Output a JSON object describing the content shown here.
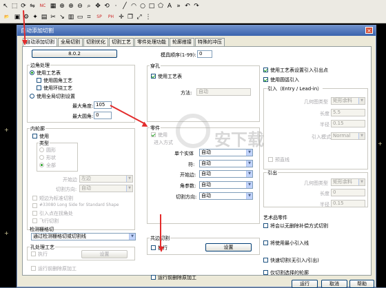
{
  "toolbar": {
    "row1_icons": [
      "cursor-icon",
      "select-icon",
      "rotate-icon",
      "mirror-icon",
      "nc-icon",
      "layout-icon",
      "zoom-icon",
      "zoom-in-icon",
      "zoom-out-icon",
      "zoom-window-icon",
      "pan-icon",
      "refresh-icon",
      "point-icon",
      "line-icon",
      "arc-icon",
      "circle-icon",
      "rect-icon",
      "polygon-icon",
      "text-icon",
      "more-icon",
      "undo-icon",
      "redo-icon"
    ],
    "row1_glyphs": [
      "↖",
      "⬚",
      "⟳",
      "⇋",
      "NC",
      "▦",
      "⊕",
      "⊕",
      "⊖",
      "⌕",
      "✥",
      "⟲",
      "·",
      "╱",
      "◠",
      "○",
      "□",
      "⬠",
      "A",
      "»",
      "↶",
      "↷"
    ],
    "row2_icons": [
      "open-icon",
      "save-icon",
      "part-icon",
      "nest-icon",
      "sheet-icon",
      "cut-icon",
      "lead-icon",
      "table-icon",
      "plate-icon",
      "grid-icon",
      "sp-icon",
      "ph-icon",
      "move-icon",
      "copy-icon",
      "scale-icon",
      "array-icon"
    ],
    "row2_glyphs": [
      "📂",
      "▣",
      "⚙",
      "✦",
      "▤",
      "✂",
      "↘",
      "▥",
      "▭",
      "⌗",
      "SP",
      "PH",
      "✛",
      "❐",
      "⤢",
      "⋮"
    ]
  },
  "dialog": {
    "title": "自动添加切割",
    "close": "×",
    "tabs": [
      "自动添加切割",
      "全局切割",
      "切割优化",
      "切割工艺",
      "零件处理功能",
      "轮廓搭接",
      "特殊的冲压"
    ],
    "active_tab": 0,
    "version_button": "8.0.2",
    "module_order_label": "模具顺序(1-99):",
    "module_order_value": "0",
    "corner": {
      "title": "边角处理",
      "use_table": "使用工艺表",
      "use_round": "使用圆角工艺",
      "use_loop": "使用环绕工艺",
      "use_global": "使用全局切割设置",
      "max_angle_label": "最大角度:",
      "max_angle_value": "105",
      "max_radius_label": "最大圆角:",
      "max_radius_value": "0"
    },
    "inner": {
      "title": "内轮廓",
      "use": "使用",
      "type_title": "类型",
      "type_round": "圆形",
      "type_shape": "形状",
      "type_all": "全部",
      "start_edge_label": "开始边",
      "start_edge_value": "左边",
      "cut_dir_label": "切割方向:",
      "cut_dir_value": "自动",
      "opt1": "短边为标准切割",
      "opt2": "#33080 Long Side for Standard Shape",
      "opt3": "引入点在拐角处",
      "opt4": "飞行切割",
      "grid_title": "检测栅格切",
      "grid_value": "通过检测栅格切或切割线",
      "hole_title": "孔处理工艺",
      "hole_exec": "执行",
      "hole_setting": "设置",
      "before_remove": "运行前删除原加工"
    },
    "pierce": {
      "title": "穿孔",
      "use_table": "使用工艺表",
      "method_label": "方法:",
      "method_value": "自动"
    },
    "part": {
      "title": "零件",
      "use": "使用",
      "lead_dir": "进入方式",
      "single_label": "单个实体",
      "single_value": "自动",
      "fill_label": "符:",
      "fill_value": "自动",
      "start_edge_label": "开始边:",
      "start_edge_value": "自动",
      "angle_label": "角参数:",
      "angle_value": "自动",
      "cut_dir_label": "切割方向:",
      "cut_dir_value": "自动"
    },
    "common": {
      "title": "共边切割",
      "exec": "执行",
      "setting": "设置"
    },
    "run_before_remove": "运行前删除原加工",
    "right": {
      "use_table_lead": "使用工艺表设置引入引出点",
      "use_round_lead": "使用圆弧引入",
      "lead_in_title": "引入（Entry / Lead-in）",
      "geom_type_label": "几何图类型",
      "geom_type_value": "矩形余料",
      "length_label": "长度",
      "length_value": "5.5",
      "radius_label": "半径",
      "radius_value": "0.15",
      "lead_mode_label": "引入模式",
      "lead_mode_value": "Normal",
      "preview": "预直线",
      "lead_out_title": "引出",
      "out_geom_type_label": "几何图类型",
      "out_geom_type_value": "矩形余料",
      "out_length_label": "长度",
      "out_length_value": "0",
      "out_radius_label": "半径",
      "out_radius_value": "0.15",
      "art_title": "艺术品零件",
      "art_opt1": "将会以无删除补偿方式切割",
      "art_opt2": "将使用最小引入线",
      "fast_cut": "快速切割(无引入/引出)",
      "only_selected": "仅切割选择的轮廓"
    },
    "buttons": {
      "run": "运行",
      "cancel": "取消",
      "help": "帮助"
    },
    "watermark": "安下载"
  }
}
